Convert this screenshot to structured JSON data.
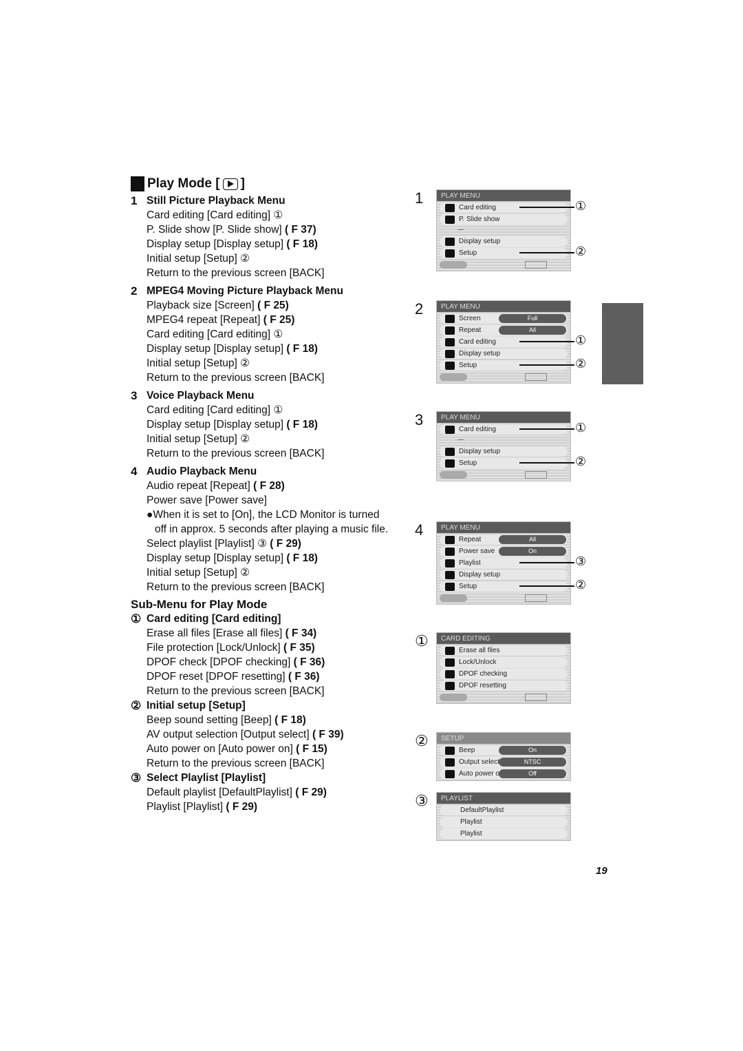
{
  "page": {
    "number": "19"
  },
  "title": {
    "text": "Play Mode [",
    "close": "]"
  },
  "sections": [
    {
      "num": "1",
      "heading": "Still Picture Playback Menu",
      "lines": [
        {
          "text": "Card editing [Card editing] ①",
          "ref": ""
        },
        {
          "text": "P. Slide show [P. Slide show] ",
          "ref": "( F 37)"
        },
        {
          "text": "Display setup [Display setup] ",
          "ref": "( F 18)"
        },
        {
          "text": "Initial setup [Setup] ②",
          "ref": ""
        },
        {
          "text": "Return to the previous screen [BACK]",
          "ref": ""
        }
      ]
    },
    {
      "num": "2",
      "heading": "MPEG4 Moving Picture Playback Menu",
      "lines": [
        {
          "text": "Playback size [Screen] ",
          "ref": "( F 25)"
        },
        {
          "text": "MPEG4 repeat [Repeat] ",
          "ref": "( F 25)"
        },
        {
          "text": "Card editing [Card editing] ①",
          "ref": ""
        },
        {
          "text": "Display setup [Display setup] ",
          "ref": "( F 18)"
        },
        {
          "text": "Initial setup [Setup] ②",
          "ref": ""
        },
        {
          "text": "Return to the previous screen [BACK]",
          "ref": ""
        }
      ]
    },
    {
      "num": "3",
      "heading": "Voice Playback Menu",
      "lines": [
        {
          "text": "Card editing [Card editing] ①",
          "ref": ""
        },
        {
          "text": "Display setup [Display setup] ",
          "ref": "( F 18)"
        },
        {
          "text": "Initial setup [Setup] ②",
          "ref": ""
        },
        {
          "text": "Return to the previous screen [BACK]",
          "ref": ""
        }
      ]
    },
    {
      "num": "4",
      "heading": "Audio Playback Menu",
      "lines": [
        {
          "text": "Audio repeat [Repeat] ",
          "ref": "( F 28)"
        },
        {
          "text": "Power save [Power save]",
          "ref": ""
        }
      ],
      "bullet": [
        "●When it is set to [On], the LCD Monitor is turned",
        "off in approx. 5 seconds after playing a music file."
      ],
      "lines2": [
        {
          "text": "Select playlist [Playlist] ③ ",
          "ref": "( F 29)"
        },
        {
          "text": "Display setup [Display setup] ",
          "ref": "( F 18)"
        },
        {
          "text": "Initial setup [Setup] ②",
          "ref": ""
        },
        {
          "text": "Return to the previous screen [BACK]",
          "ref": ""
        }
      ]
    }
  ],
  "submenu": {
    "title": "Sub-Menu for Play Mode",
    "groups": [
      {
        "num": "①",
        "heading": "Card editing [Card editing]",
        "lines": [
          {
            "text": "Erase all files [Erase all files] ",
            "ref": "( F 34)"
          },
          {
            "text": "File protection [Lock/Unlock] ",
            "ref": "( F 35)"
          },
          {
            "text": "DPOF check [DPOF checking] ",
            "ref": "( F 36)"
          },
          {
            "text": "DPOF reset [DPOF resetting] ",
            "ref": "( F 36)"
          },
          {
            "text": "Return to the previous screen [BACK]",
            "ref": ""
          }
        ]
      },
      {
        "num": "②",
        "heading": "Initial setup [Setup]",
        "lines": [
          {
            "text": "Beep sound setting [Beep] ",
            "ref": "( F 18)"
          },
          {
            "text": "AV output selection [Output select] ",
            "ref": "( F 39)"
          },
          {
            "text": "Auto power on [Auto power on] ",
            "ref": "( F 15)"
          },
          {
            "text": "Return to the previous screen [BACK]",
            "ref": ""
          }
        ]
      },
      {
        "num": "③",
        "heading": "Select Playlist [Playlist]",
        "lines": [
          {
            "text": "Default playlist [DefaultPlaylist] ",
            "ref": "( F 29)"
          },
          {
            "text": "Playlist [Playlist] ",
            "ref": "( F 29)"
          }
        ]
      }
    ]
  },
  "screens": {
    "labels": [
      "1",
      "2",
      "3",
      "4",
      "①",
      "②",
      "③"
    ],
    "s1": {
      "hdr": "PLAY MENU",
      "rows": [
        "Card editing",
        "P. Slide show",
        "Display setup",
        "Setup"
      ]
    },
    "s2": {
      "hdr": "PLAY MENU",
      "rows": [
        "Screen",
        "Repeat",
        "Card editing",
        "Display setup",
        "Setup"
      ],
      "vals": [
        "Full",
        "All"
      ]
    },
    "s3": {
      "hdr": "PLAY MENU",
      "rows": [
        "Card editing",
        "Display setup",
        "Setup"
      ]
    },
    "s4": {
      "hdr": "PLAY MENU",
      "rows": [
        "Repeat",
        "Power save",
        "Playlist",
        "Display setup",
        "Setup"
      ],
      "vals": [
        "All",
        "On"
      ]
    },
    "c1": {
      "hdr": "CARD EDITING",
      "rows": [
        "Erase all files",
        "Lock/Unlock",
        "DPOF checking",
        "DPOF resetting"
      ]
    },
    "c2": {
      "hdr": "SETUP",
      "rows": [
        "Beep",
        "Output select",
        "Auto power on"
      ],
      "vals": [
        "On",
        "NTSC",
        "Off"
      ]
    },
    "c3": {
      "hdr": "PLAYLIST",
      "rows": [
        "DefaultPlaylist",
        "Playlist",
        "Playlist"
      ]
    }
  }
}
